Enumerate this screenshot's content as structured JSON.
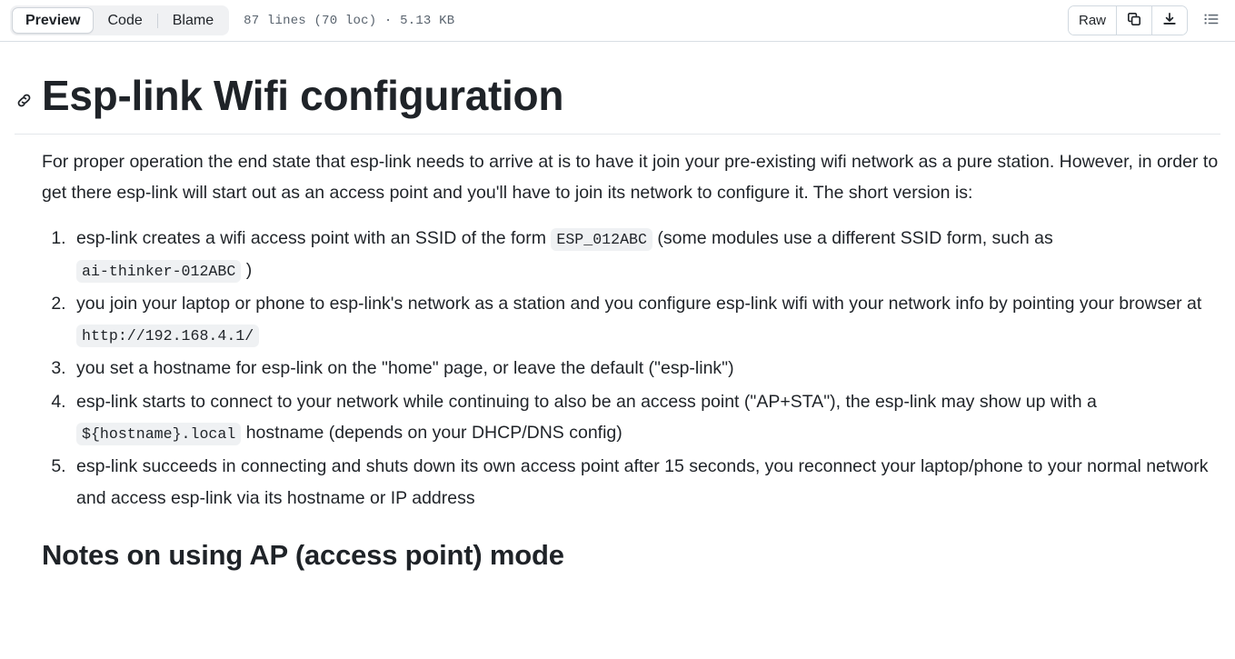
{
  "toolbar": {
    "tabs": [
      {
        "id": "preview",
        "label": "Preview",
        "active": true
      },
      {
        "id": "code",
        "label": "Code",
        "active": false
      },
      {
        "id": "blame",
        "label": "Blame",
        "active": false
      }
    ],
    "file_meta": "87 lines (70 loc) · 5.13 KB",
    "raw_label": "Raw",
    "copy_icon": "copy-icon",
    "download_icon": "download-icon",
    "outline_icon": "outline-list-icon"
  },
  "document": {
    "anchor_icon": "link-anchor-icon",
    "title": "Esp-link Wifi configuration",
    "intro": "For proper operation the end state that esp-link needs to arrive at is to have it join your pre-existing wifi network as a pure station. However, in order to get there esp-link will start out as an access point and you'll have to join its network to configure it. The short version is:",
    "steps": [
      {
        "num": 1,
        "parts": [
          {
            "type": "text",
            "value": "esp-link creates a wifi access point with an SSID of the form "
          },
          {
            "type": "code",
            "value": "ESP_012ABC"
          },
          {
            "type": "text",
            "value": " (some modules use a different SSID form, such as "
          },
          {
            "type": "code",
            "value": "ai-thinker-012ABC"
          },
          {
            "type": "text",
            "value": " )"
          }
        ]
      },
      {
        "num": 2,
        "parts": [
          {
            "type": "text",
            "value": "you join your laptop or phone to esp-link's network as a station and you configure esp-link wifi with your network info by pointing your browser at "
          },
          {
            "type": "code",
            "value": "http://192.168.4.1/"
          }
        ]
      },
      {
        "num": 3,
        "parts": [
          {
            "type": "text",
            "value": "you set a hostname for esp-link on the \"home\" page, or leave the default (\"esp-link\")"
          }
        ]
      },
      {
        "num": 4,
        "parts": [
          {
            "type": "text",
            "value": "esp-link starts to connect to your network while continuing to also be an access point (\"AP+STA\"), the esp-link may show up with a "
          },
          {
            "type": "code",
            "value": "${hostname}.local"
          },
          {
            "type": "text",
            "value": " hostname (depends on your DHCP/DNS config)"
          }
        ]
      },
      {
        "num": 5,
        "parts": [
          {
            "type": "text",
            "value": "esp-link succeeds in connecting and shuts down its own access point after 15 seconds, you reconnect your laptop/phone to your normal network and access esp-link via its hostname or IP address"
          }
        ]
      }
    ],
    "section_heading": "Notes on using AP (access point) mode"
  },
  "colors": {
    "text": "#1f2328",
    "muted": "#59636e",
    "border": "#d1d9e0",
    "code_bg": "#eff1f3",
    "segment_bg": "#f0f1f3"
  }
}
